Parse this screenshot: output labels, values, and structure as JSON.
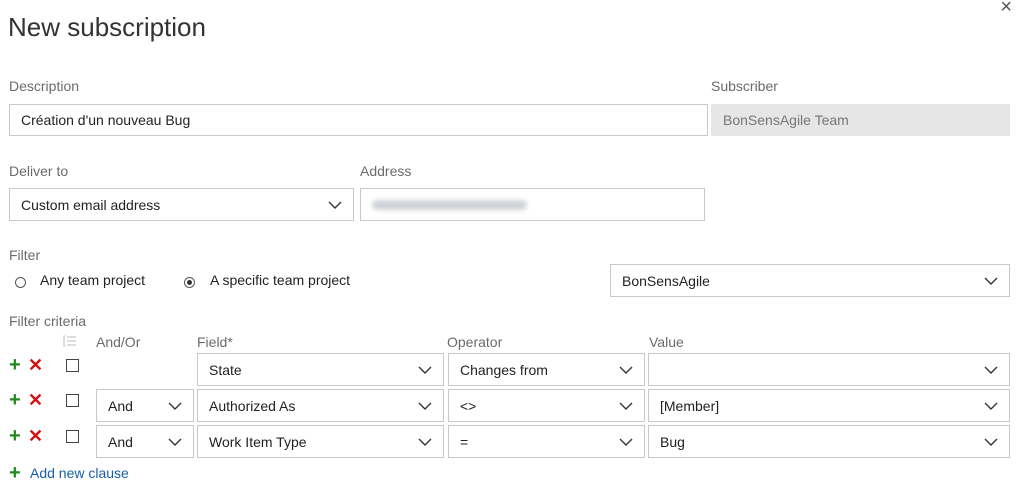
{
  "dialog": {
    "title": "New subscription",
    "close_icon": "×"
  },
  "description": {
    "label": "Description",
    "value": "Création d'un nouveau Bug"
  },
  "subscriber": {
    "label": "Subscriber",
    "value": "BonSensAgile Team"
  },
  "deliver_to": {
    "label": "Deliver to",
    "value": "Custom email address"
  },
  "address": {
    "label": "Address"
  },
  "filter": {
    "label": "Filter",
    "options": [
      "Any team project",
      "A specific team project"
    ],
    "selected": "A specific team project",
    "project": "BonSensAgile"
  },
  "criteria": {
    "label": "Filter criteria",
    "headers": {
      "andor": "And/Or",
      "field": "Field*",
      "operator": "Operator",
      "value": "Value"
    },
    "rows": [
      {
        "andor": "",
        "field": "State",
        "operator": "Changes from",
        "value": ""
      },
      {
        "andor": "And",
        "field": "Authorized As",
        "operator": "<>",
        "value": "[Member]"
      },
      {
        "andor": "And",
        "field": "Work Item Type",
        "operator": "=",
        "value": "Bug"
      }
    ],
    "add_clause": "Add new clause"
  },
  "icons": {
    "plus": "+",
    "delete": "✕"
  },
  "colors": {
    "plus": "#1e8a1e",
    "delete": "#d11212",
    "link": "#1a5fa8"
  }
}
